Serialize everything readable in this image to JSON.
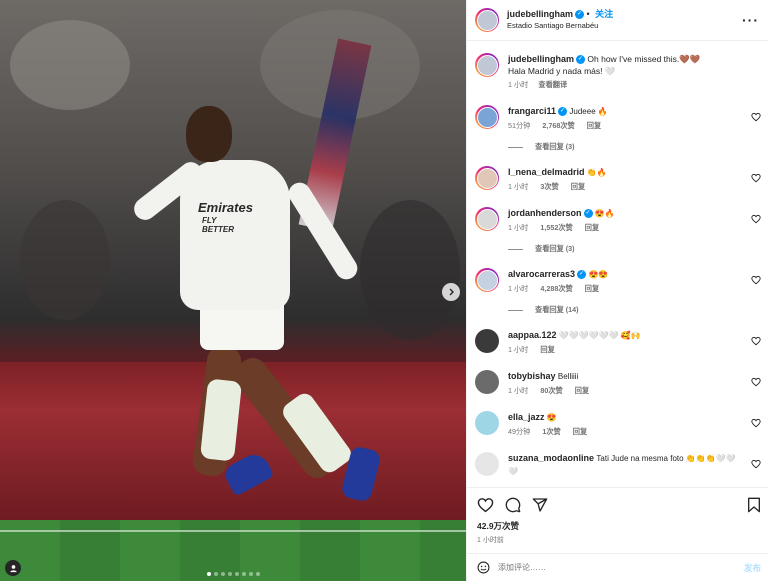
{
  "media": {
    "sponsor": "Emirates",
    "sponsor_tagline": "FLY BETTER",
    "carousel": {
      "count": 8,
      "active_index": 0
    }
  },
  "post": {
    "username": "judebellingham",
    "follow_label": "关注",
    "location": "Estadio Santiago Bernabéu",
    "caption": {
      "username": "judebellingham",
      "line1": "Oh how I've missed this.🤎🤎",
      "line2": "Hala Madrid y nada más! 🤍",
      "time": "1 小时",
      "translate": "查看翻译"
    },
    "likes": "42.9万次赞",
    "time": "1 小时前",
    "comment_placeholder": "添加评论……",
    "post_label": "发布"
  },
  "comments": [
    {
      "username": "frangarci11",
      "verified": true,
      "text": "Judeee 🔥",
      "time": "51分钟",
      "likes": "2,768次赞",
      "reply": "回复",
      "replies": "查看回复 (3)"
    },
    {
      "username": "l_nena_delmadrid",
      "verified": false,
      "text": "👏🔥",
      "time": "1 小时",
      "likes": "3次赞",
      "reply": "回复",
      "replies": ""
    },
    {
      "username": "jordanhenderson",
      "verified": true,
      "text": "😍🔥",
      "time": "1 小时",
      "likes": "1,552次赞",
      "reply": "回复",
      "replies": "查看回复 (3)"
    },
    {
      "username": "alvarocarreras3",
      "verified": true,
      "text": "😍😍",
      "time": "1 小时",
      "likes": "4,288次赞",
      "reply": "回复",
      "replies": "查看回复 (14)"
    },
    {
      "username": "aappaa.122",
      "verified": false,
      "text": "🤍🤍🤍🤍🤍🤍 🥰🙌",
      "time": "1 小时",
      "likes": "",
      "reply": "回复",
      "replies": ""
    },
    {
      "username": "tobybishay",
      "verified": false,
      "text": "Belliiii",
      "time": "1 小时",
      "likes": "80次赞",
      "reply": "回复",
      "replies": ""
    },
    {
      "username": "ella_jazz",
      "verified": false,
      "text": "😍",
      "time": "49分钟",
      "likes": "1次赞",
      "reply": "回复",
      "replies": ""
    },
    {
      "username": "suzana_modaonline",
      "verified": false,
      "text": "Tati Jude na mesma foto 👏👏👏🤍🤍🤍",
      "time": "",
      "likes": "",
      "reply": "",
      "replies": ""
    }
  ],
  "colors": {
    "accent": "#0095f6",
    "muted": "#737373",
    "border": "#efefef"
  },
  "icons": [
    "more-icon",
    "heart-icon",
    "comment-icon",
    "share-icon",
    "bookmark-icon",
    "chevron-right-icon",
    "user-tag-icon",
    "emoji-icon"
  ]
}
